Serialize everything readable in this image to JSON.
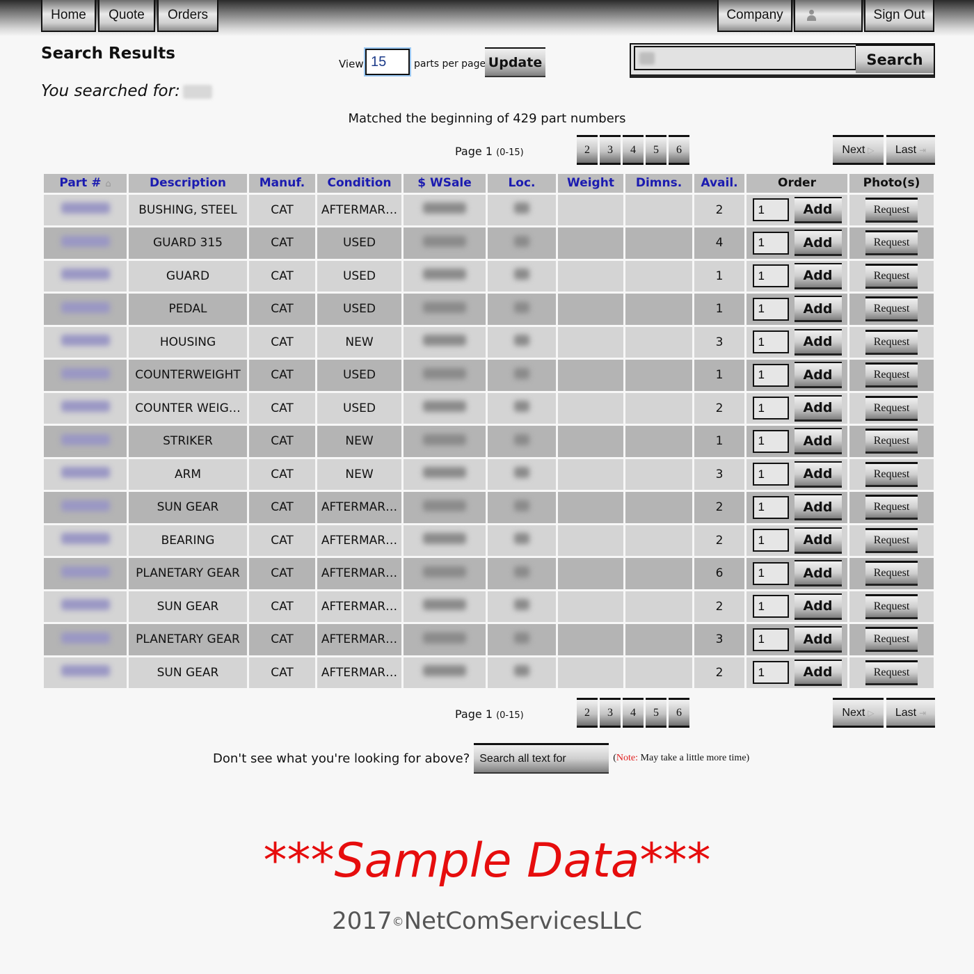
{
  "nav": {
    "left": [
      "Home",
      "Quote",
      "Orders"
    ],
    "right": {
      "company": "Company",
      "user_icon": "user-icon",
      "sign_out": "Sign Out"
    }
  },
  "header": {
    "title": "Search Results",
    "searched_for_label": "You searched for:",
    "view_label": "View",
    "per_page_value": "15",
    "per_page_suffix": "parts per page",
    "update_label": "Update",
    "search_label": "Search"
  },
  "summary": {
    "matched_text": "Matched the beginning of 429 part numbers"
  },
  "pagination": {
    "page_label": "Page 1",
    "range": "(0-15)",
    "pages": [
      "2",
      "3",
      "4",
      "5",
      "6"
    ],
    "next_label": "Next",
    "last_label": "Last"
  },
  "table": {
    "columns": [
      "Part #",
      "Description",
      "Manuf.",
      "Condition",
      "$ WSale",
      "Loc.",
      "Weight",
      "Dimns.",
      "Avail.",
      "Order",
      "Photo(s)"
    ],
    "sort_indicator": "sort-ascending-icon",
    "add_label": "Add",
    "request_label": "Request",
    "rows": [
      {
        "description": "BUSHING, STEEL",
        "manuf": "CAT",
        "condition": "AFTERMAR…",
        "weight": "",
        "dimns": "",
        "avail": "2",
        "qty": "1"
      },
      {
        "description": "GUARD 315",
        "manuf": "CAT",
        "condition": "USED",
        "weight": "",
        "dimns": "",
        "avail": "4",
        "qty": "1"
      },
      {
        "description": "GUARD",
        "manuf": "CAT",
        "condition": "USED",
        "weight": "",
        "dimns": "",
        "avail": "1",
        "qty": "1"
      },
      {
        "description": "PEDAL",
        "manuf": "CAT",
        "condition": "USED",
        "weight": "",
        "dimns": "",
        "avail": "1",
        "qty": "1"
      },
      {
        "description": "HOUSING",
        "manuf": "CAT",
        "condition": "NEW",
        "weight": "",
        "dimns": "",
        "avail": "3",
        "qty": "1"
      },
      {
        "description": "COUNTERWEIGHT",
        "manuf": "CAT",
        "condition": "USED",
        "weight": "",
        "dimns": "",
        "avail": "1",
        "qty": "1"
      },
      {
        "description": "COUNTER WEIG…",
        "manuf": "CAT",
        "condition": "USED",
        "weight": "",
        "dimns": "",
        "avail": "2",
        "qty": "1"
      },
      {
        "description": "STRIKER",
        "manuf": "CAT",
        "condition": "NEW",
        "weight": "",
        "dimns": "",
        "avail": "1",
        "qty": "1"
      },
      {
        "description": "ARM",
        "manuf": "CAT",
        "condition": "NEW",
        "weight": "",
        "dimns": "",
        "avail": "3",
        "qty": "1"
      },
      {
        "description": "SUN GEAR",
        "manuf": "CAT",
        "condition": "AFTERMAR…",
        "weight": "",
        "dimns": "",
        "avail": "2",
        "qty": "1"
      },
      {
        "description": "BEARING",
        "manuf": "CAT",
        "condition": "AFTERMAR…",
        "weight": "",
        "dimns": "",
        "avail": "2",
        "qty": "1"
      },
      {
        "description": "PLANETARY GEAR",
        "manuf": "CAT",
        "condition": "AFTERMAR…",
        "weight": "",
        "dimns": "",
        "avail": "6",
        "qty": "1"
      },
      {
        "description": "SUN GEAR",
        "manuf": "CAT",
        "condition": "AFTERMAR…",
        "weight": "",
        "dimns": "",
        "avail": "2",
        "qty": "1"
      },
      {
        "description": "PLANETARY GEAR",
        "manuf": "CAT",
        "condition": "AFTERMAR…",
        "weight": "",
        "dimns": "",
        "avail": "3",
        "qty": "1"
      },
      {
        "description": "SUN GEAR",
        "manuf": "CAT",
        "condition": "AFTERMAR…",
        "weight": "",
        "dimns": "",
        "avail": "2",
        "qty": "1"
      }
    ]
  },
  "footer": {
    "dont_see": "Don't see what you're looking for above?",
    "search_all_label": "Search all text for",
    "note_open": "(",
    "note_label": "Note:",
    "note_text": " May take a little more time)",
    "sample_banner": "***Sample Data***",
    "copyright_year": "2017",
    "copyright_symbol": "©",
    "copyright_owner": "NetComServicesLLC"
  },
  "colors": {
    "header_link": "#1b1bb0",
    "banner_red": "#e60d0d",
    "note_red": "#e02020"
  }
}
